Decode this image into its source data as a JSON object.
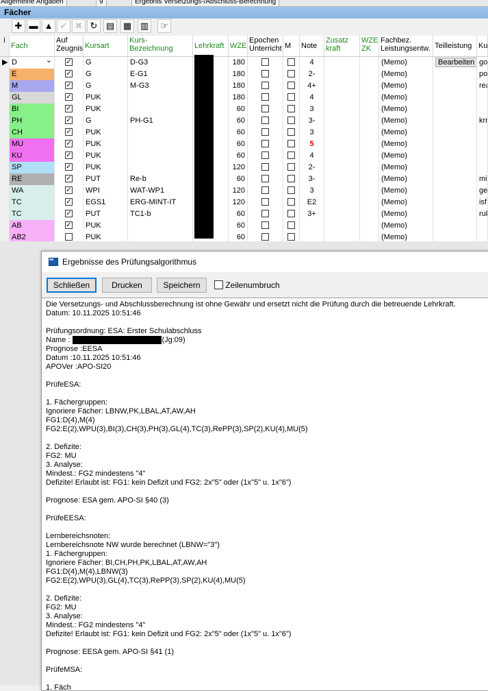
{
  "top_tabs": [
    "Allgemeine Angaben",
    "9",
    "Ergebnis Versetzungs-/Abschluss-Berechnung"
  ],
  "section_title": "Fächer",
  "columns": {
    "fach": "Fach",
    "auf": "Auf\nZeugnis",
    "kursart": "Kursart",
    "kursbez": "Kurs-\nBezeichnung",
    "lehrkraft": "Lehrkraft",
    "wze": "WZE",
    "epochen": "Epochen\nUnterricht",
    "m": "M",
    "note": "Note",
    "zusatz": "Zusatz\nkraft",
    "wzezk": "WZE\nZK",
    "fachbez": "Fachbez.\nLeistungsentw.",
    "teil": "Teilleistung",
    "ku": "Ku"
  },
  "rows": [
    {
      "fach": "D",
      "color": "#ffffff",
      "auf": true,
      "kursart": "G",
      "kursbez": "D-G3",
      "wze": "180",
      "note": "4",
      "memo": "(Memo)",
      "teil": "Bearbeiten",
      "ku": "go",
      "dropdown": true
    },
    {
      "fach": "E",
      "color": "#f7b06a",
      "auf": true,
      "kursart": "G",
      "kursbez": "E-G1",
      "wze": "180",
      "note": "2-",
      "memo": "(Memo)",
      "teil": "",
      "ku": "po"
    },
    {
      "fach": "M",
      "color": "#a8a8f0",
      "auf": true,
      "kursart": "G",
      "kursbez": "M-G3",
      "wze": "180",
      "note": "4+",
      "memo": "(Memo)",
      "teil": "",
      "ku": "rea"
    },
    {
      "fach": "GL",
      "color": "#d8d8d8",
      "auf": true,
      "kursart": "PUK",
      "kursbez": "",
      "wze": "180",
      "note": "4",
      "memo": "(Memo)",
      "teil": "",
      "ku": ""
    },
    {
      "fach": "BI",
      "color": "#88f088",
      "auf": true,
      "kursart": "PUK",
      "kursbez": "",
      "wze": "60",
      "note": "3",
      "memo": "(Memo)",
      "teil": "",
      "ku": ""
    },
    {
      "fach": "PH",
      "color": "#88f088",
      "auf": true,
      "kursart": "G",
      "kursbez": "PH-G1",
      "wze": "60",
      "note": "3-",
      "memo": "(Memo)",
      "teil": "",
      "ku": "krn"
    },
    {
      "fach": "CH",
      "color": "#88f088",
      "auf": true,
      "kursart": "PUK",
      "kursbez": "",
      "wze": "60",
      "note": "3",
      "memo": "(Memo)",
      "teil": "",
      "ku": ""
    },
    {
      "fach": "MU",
      "color": "#f070f0",
      "auf": true,
      "kursart": "PUK",
      "kursbez": "",
      "wze": "60",
      "note": "5",
      "red": true,
      "memo": "(Memo)",
      "teil": "",
      "ku": ""
    },
    {
      "fach": "KU",
      "color": "#f070f0",
      "auf": true,
      "kursart": "PUK",
      "kursbez": "",
      "wze": "60",
      "note": "4",
      "memo": "(Memo)",
      "teil": "",
      "ku": ""
    },
    {
      "fach": "SP",
      "color": "#b0e0f8",
      "auf": true,
      "kursart": "PUK",
      "kursbez": "",
      "wze": "120",
      "note": "2-",
      "memo": "(Memo)",
      "teil": "",
      "ku": ""
    },
    {
      "fach": "RE",
      "color": "#b0b0b0",
      "auf": true,
      "kursart": "PUT",
      "kursbez": "Re-b",
      "wze": "60",
      "note": "3-",
      "memo": "(Memo)",
      "teil": "",
      "ku": "mi"
    },
    {
      "fach": "WA",
      "color": "#d8eeea",
      "auf": true,
      "kursart": "WPI",
      "kursbez": "WAT-WP1",
      "wze": "120",
      "note": "3",
      "memo": "(Memo)",
      "teil": "",
      "ku": "ge"
    },
    {
      "fach": "TC",
      "color": "#d8eeea",
      "auf": true,
      "kursart": "EGS1",
      "kursbez": "ERG-MINT-IT",
      "wze": "120",
      "note": "E2",
      "memo": "(Memo)",
      "teil": "",
      "ku": "isf"
    },
    {
      "fach": "TC",
      "color": "#d8eeea",
      "auf": true,
      "kursart": "PUT",
      "kursbez": "TC1-b",
      "wze": "60",
      "note": "3+",
      "memo": "(Memo)",
      "teil": "",
      "ku": "ruk"
    },
    {
      "fach": "AB",
      "color": "#f8b0f8",
      "auf": true,
      "kursart": "PUK",
      "kursbez": "",
      "wze": "60",
      "note": "",
      "memo": "(Memo)",
      "teil": "",
      "ku": ""
    },
    {
      "fach": "AB2",
      "color": "#f8b0f8",
      "auf": false,
      "kursart": "PUK",
      "kursbez": "",
      "wze": "60",
      "note": "",
      "memo": "(Memo)",
      "teil": "",
      "ku": ""
    }
  ],
  "dialog": {
    "title": "Ergebnisse des Prüfungsalgorithmus",
    "btn_close": "Schließen",
    "btn_print": "Drucken",
    "btn_save": "Speichern",
    "wrap_label": "Zeilenumbruch",
    "lines": [
      "Die Versetzungs- und Abschlussberechnung ist ohne Gewähr und ersetzt nicht die Prüfung durch die betreuende Lehrkraft.",
      "Datum: 10.11.2025 10:51:46",
      "",
      "Prüfungsordnung: ESA: Erster Schulabschluss",
      "Name :",
      "Prognose :EESA",
      "Datum :10.11.2025 10:51:46",
      "APOVer :APO-SI20",
      "",
      "PrüfeESA:",
      "",
      "1. Fächergruppen:",
      "Ignoriere Fächer: LBNW,PK,LBAL,AT,AW,AH",
      "FG1:D(4),M(4)",
      "FG2:E(2),WPU(3),BI(3),CH(3),PH(3),GL(4),TC(3),RePP(3),SP(2),KU(4),MU(5)",
      "",
      "2. Defizite:",
      "FG2: MU",
      "3. Analyse:",
      "Mindest.: FG2 mindestens \"4\"",
      "Defizite! Erlaubt ist: FG1: kein Defizit und FG2: 2x\"5\" oder (1x\"5\" u. 1x\"6\")",
      "",
      "Prognose: ESA gem. APO-SI §40 (3)",
      "",
      "PrüfeEESA:",
      "",
      "Lernbereichsnoten:",
      "Lernbereichsnote NW wurde berechnet (LBNW=\"3\")",
      "1. Fächergruppen:",
      "Ignoriere Fächer: BI,CH,PH,PK,LBAL,AT,AW,AH",
      "FG1:D(4),M(4),LBNW(3)",
      "FG2:E(2),WPU(3),GL(4),TC(3),RePP(3),SP(2),KU(4),MU(5)",
      "",
      "2. Defizite:",
      "FG2: MU",
      "3. Analyse:",
      "Mindest.: FG2 mindestens \"4\"",
      "Defizite! Erlaubt ist: FG1: kein Defizit und FG2: 2x\"5\" oder (1x\"5\" u. 1x\"6\")",
      "",
      "Prognose: EESA gem. APO-SI §41 (1)",
      "",
      "PrüfeMSA:",
      "",
      "1. Fäch"
    ],
    "name_suffix": "(Jg:09)"
  }
}
